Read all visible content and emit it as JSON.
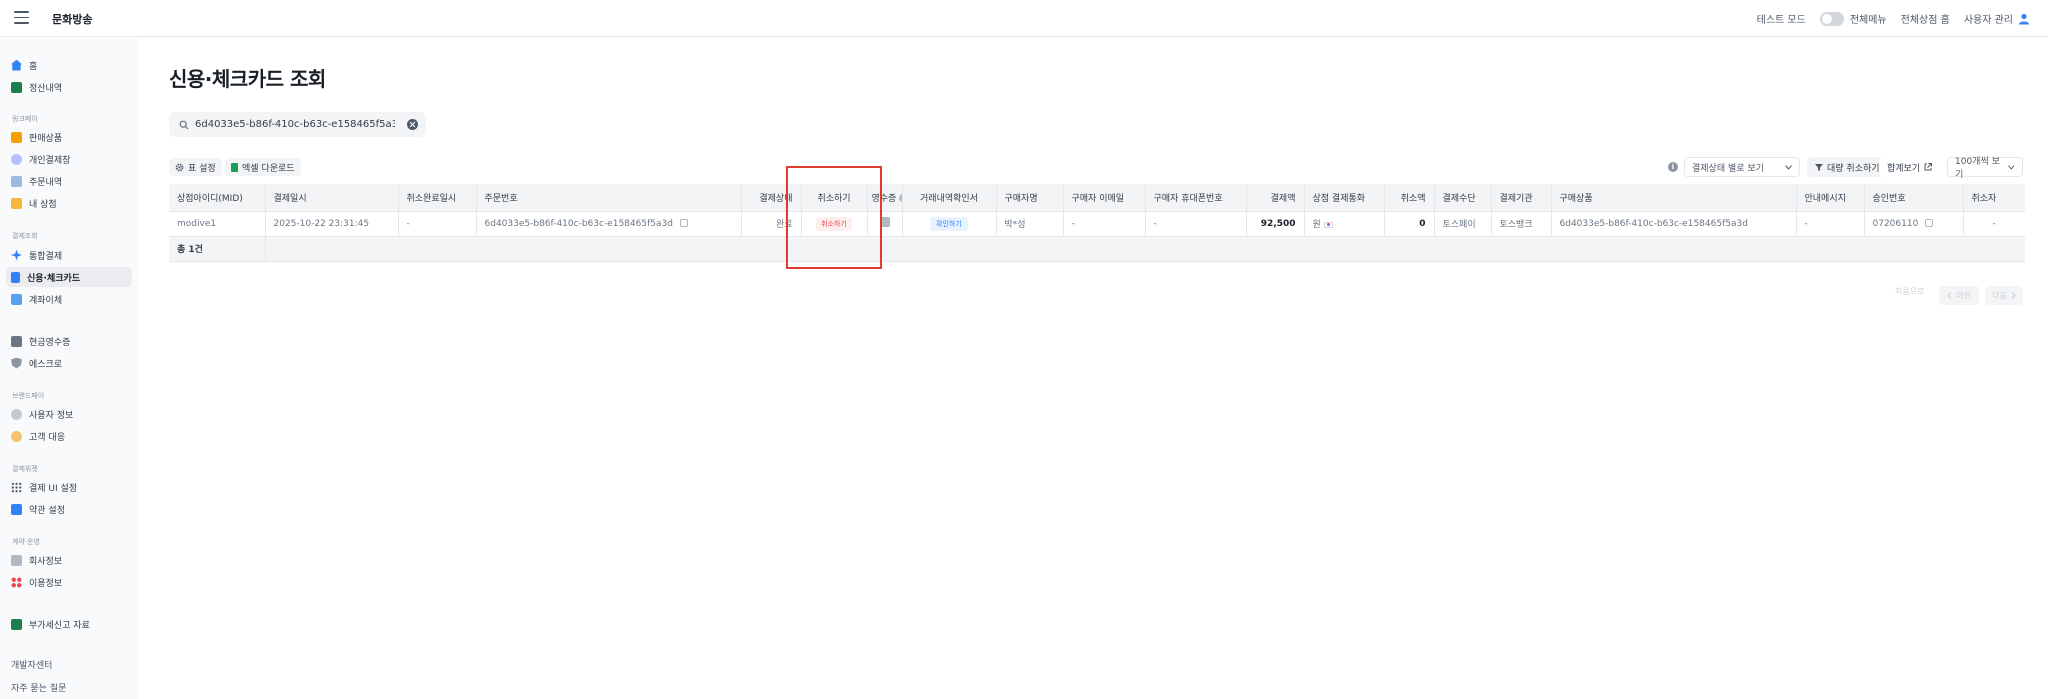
{
  "header": {
    "brand": "문화방송",
    "test_mode": "테스트 모드",
    "all_menu": "전체메뉴",
    "store_home": "전체상점 홈",
    "user_admin": "사용자 관리"
  },
  "sidebar": {
    "items": [
      {
        "label": "홈",
        "icon": "home-icon",
        "color": "#3182f6"
      },
      {
        "label": "정산내역",
        "icon": "ledger-icon",
        "color": "#1b7f4c"
      }
    ],
    "sections": [
      {
        "title": "링크페이",
        "items": [
          {
            "label": "판매상품",
            "icon": "tag-icon",
            "color": "#f59f00"
          },
          {
            "label": "개인결제창",
            "icon": "person-icon",
            "color": "#8fa0ff"
          },
          {
            "label": "주문내역",
            "icon": "list-icon",
            "color": "#7ea8d8"
          },
          {
            "label": "내 상점",
            "icon": "store-icon",
            "color": "#f5b93a"
          }
        ]
      },
      {
        "title": "결제조회",
        "items": [
          {
            "label": "통합결제",
            "icon": "sparkle-icon",
            "color": "#3182f6"
          },
          {
            "label": "신용·체크카드",
            "icon": "card-icon",
            "color": "#3182f6"
          },
          {
            "label": "계좌이체",
            "icon": "bank-transfer-icon",
            "color": "#5aa0f2"
          }
        ]
      },
      {
        "title": "",
        "items": [
          {
            "label": "현금영수증",
            "icon": "receipt-icon",
            "color": "#6b7684"
          },
          {
            "label": "에스크로",
            "icon": "shield-icon",
            "color": "#8b95a1"
          }
        ]
      },
      {
        "title": "브랜드페이",
        "items": [
          {
            "label": "사용자 정보",
            "icon": "users-icon",
            "color": "#8b95a1"
          },
          {
            "label": "고객 대응",
            "icon": "support-icon",
            "color": "#f59f00"
          }
        ]
      },
      {
        "title": "결제위젯",
        "items": [
          {
            "label": "결제 UI 설정",
            "icon": "grid-icon",
            "color": "#4e5968"
          },
          {
            "label": "약관 설정",
            "icon": "document-icon",
            "color": "#3182f6"
          }
        ]
      },
      {
        "title": "계약·운영",
        "items": [
          {
            "label": "회사정보",
            "icon": "building-icon",
            "color": "#8b95a1"
          },
          {
            "label": "이용정보",
            "icon": "dots-icon",
            "color": "#f04452"
          }
        ]
      },
      {
        "title": "",
        "items": [
          {
            "label": "부가세신고 자료",
            "icon": "tax-icon",
            "color": "#1b7f4c"
          }
        ]
      }
    ],
    "footer": [
      "개발자센터",
      "자주 묻는 질문"
    ]
  },
  "page": {
    "title": "신용·체크카드 조회",
    "search_value": "6d4033e5-b86f-410c-b63c-e158465f5a3d",
    "table_settings": "표 설정",
    "excel_download": "엑셀 다운로드",
    "status_filter": "결제상태 별로 보기",
    "bulk_cancel": "대량 취소하기",
    "sum_view": "합계보기",
    "page_size": "100개씩 보기"
  },
  "table": {
    "headers": [
      "상점아이디(MID)",
      "결제일시",
      "취소완료일시",
      "주문번호",
      "결제상태",
      "취소하기",
      "영수증",
      "거래내역확인서",
      "구매자명",
      "구매자 이메일",
      "구매자 휴대폰번호",
      "결제액",
      "상점 결제통화",
      "취소액",
      "결제수단",
      "결제기관",
      "구매상품",
      "안내메시지",
      "승인번호",
      "취소자"
    ],
    "rows": [
      {
        "mid": "modive1",
        "paid_at": "2025-10-22 23:31:45",
        "cancel_done_at": "-",
        "order_no": "6d4033e5-b86f-410c-b63c-e158465f5a3d",
        "status": "완료",
        "cancel_btn": "취소하기",
        "confirm_btn": "확인하기",
        "buyer": "박*성",
        "email": "-",
        "phone": "-",
        "amount": "92,500",
        "currency": "원",
        "cancel_amount": "0",
        "method": "토스페이",
        "institution": "토스뱅크",
        "product": "6d4033e5-b86f-410c-b63c-e158465f5a3d",
        "guide_msg": "-",
        "approval_no": "07206110",
        "canceler": "-"
      }
    ],
    "total": "총 1건"
  },
  "pagination": {
    "first": "처음으로",
    "prev": "이전",
    "next": "다음"
  },
  "colors": {
    "accent": "#3182f6",
    "highlight_box": "#e03a2e",
    "danger": "#f04452"
  }
}
